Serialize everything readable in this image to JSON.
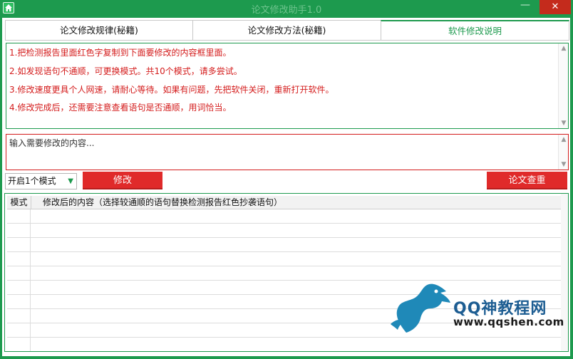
{
  "window": {
    "title": "论文修改助手1.0",
    "minimize_glyph": "—",
    "close_glyph": "✕"
  },
  "tabs": [
    {
      "label": "论文修改规律(秘籍)",
      "active": false
    },
    {
      "label": "论文修改方法(秘籍)",
      "active": false
    },
    {
      "label": "软件修改说明",
      "active": true
    }
  ],
  "instructions": [
    "1.把检测报告里面红色字复制到下面要修改的内容框里面。",
    "2.如发现语句不通顺，可更换模式。共10个模式，请多尝试。",
    "3.修改速度更具个人网速，请耐心等待。如果有问题，先把软件关闭，重新打开软件。",
    "4.修改完成后，还需要注意查看语句是否通顺，用词恰当。"
  ],
  "input": {
    "placeholder": "输入需要修改的内容..."
  },
  "controls": {
    "mode_selected": "开启1个模式",
    "modify_label": "修改",
    "check_label": "论文查重"
  },
  "grid": {
    "col_mode": "模式",
    "col_content": "修改后的内容（选择较通顺的语句替换检测报告红色抄袭语句）"
  },
  "watermark": {
    "name": "QQ神教程网",
    "url": "www.qqshen.com"
  },
  "colors": {
    "theme_green": "#1d9a4e",
    "alert_red": "#d41c1c",
    "button_red": "#e02a2a",
    "close_red": "#c42b1c"
  },
  "icons": {
    "app": "house-icon",
    "dropdown": "caret-down-icon"
  }
}
